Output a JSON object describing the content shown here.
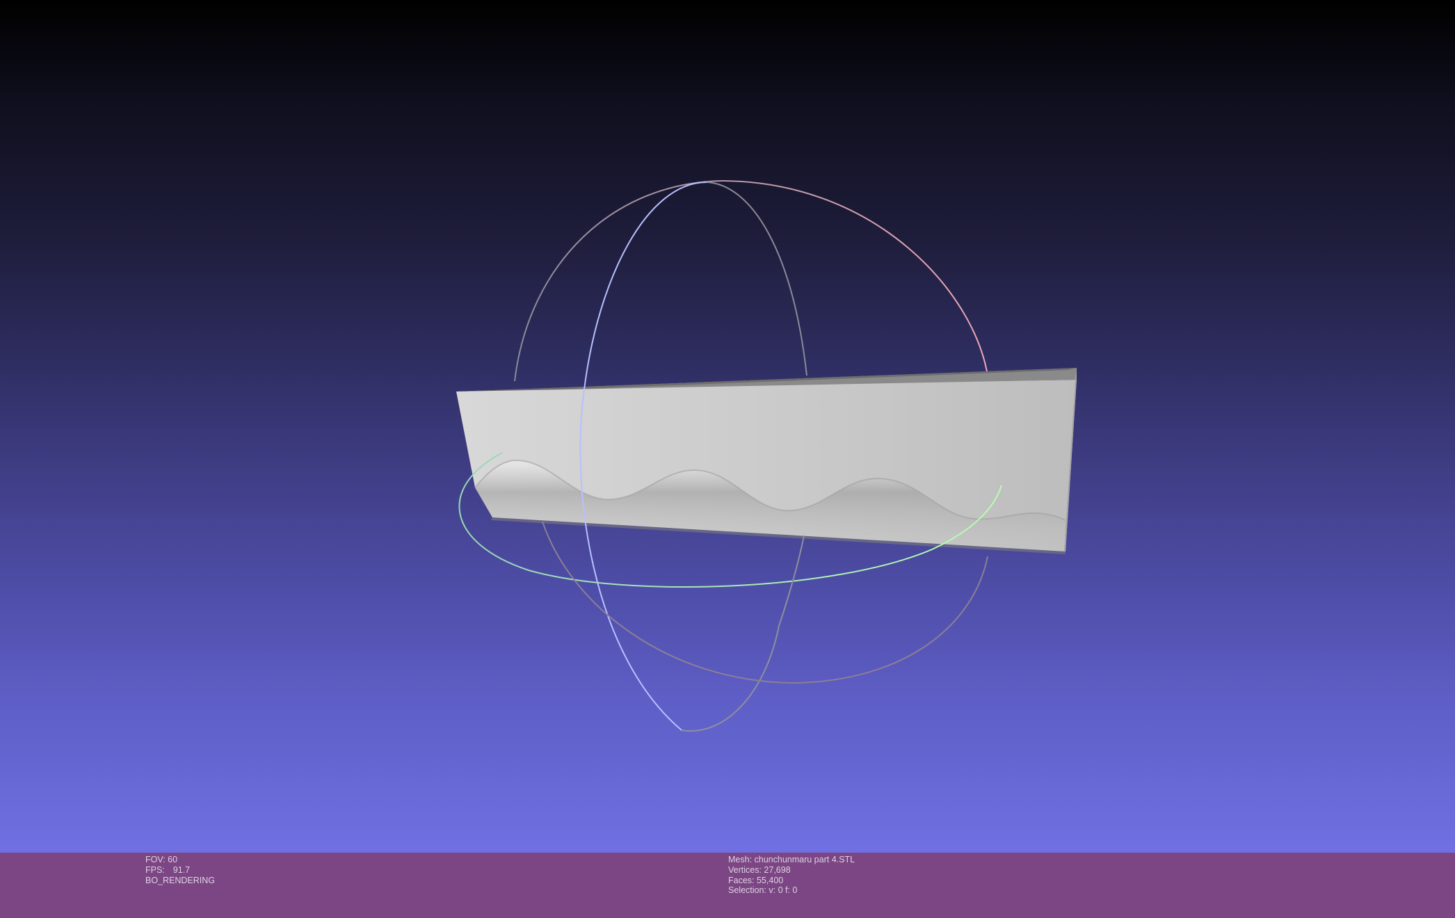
{
  "viewport": {
    "mesh_color": "#c4c4c4",
    "trackball_colors": {
      "x_ring": "#f0a8b8",
      "y_ring": "#b8c0ff",
      "z_ring": "#a8f0b0"
    }
  },
  "info_left": {
    "fov": "FOV: 60",
    "fps_label": "FPS:",
    "fps_value": "91.7",
    "render_mode": "BO_RENDERING"
  },
  "info_right": {
    "mesh": "Mesh: chunchunmaru part 4.STL",
    "vertices": "Vertices: 27,698",
    "faces": "Faces: 55,400",
    "selection": "Selection: v: 0 f: 0"
  },
  "colors": {
    "info_bar": "#7c4583",
    "info_text": "#ddd4e6"
  }
}
